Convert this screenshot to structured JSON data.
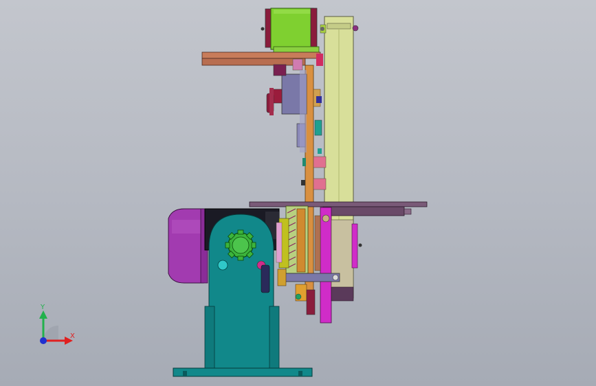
{
  "viewport": {
    "background_top": "#c3c6cd",
    "background_bottom": "#a6abb5"
  },
  "triad": {
    "y_label": "Y",
    "x_label": "X",
    "y_color": "#22b14c",
    "x_color": "#e02020",
    "z_color": "#2030d0"
  },
  "model": {
    "parts": [
      "upper-motor",
      "vertical-rail",
      "horizontal-arm",
      "slide-plate",
      "knob-handle",
      "main-motor",
      "gear-housing",
      "drive-gear",
      "base-plate",
      "cross-beam",
      "rack-gear",
      "lower-bracket"
    ],
    "colors": {
      "green_motor": "#7fd030",
      "rail_yellow": "#d8df9a",
      "teal_body": "#11888a",
      "purple_motor": "#a23bb0",
      "magenta": "#d02cc8",
      "orange": "#d99040",
      "salmon": "#c87c5a",
      "slate": "#7a78a8",
      "crimson": "#8a1c3c",
      "beam": "#7a5a78"
    }
  }
}
